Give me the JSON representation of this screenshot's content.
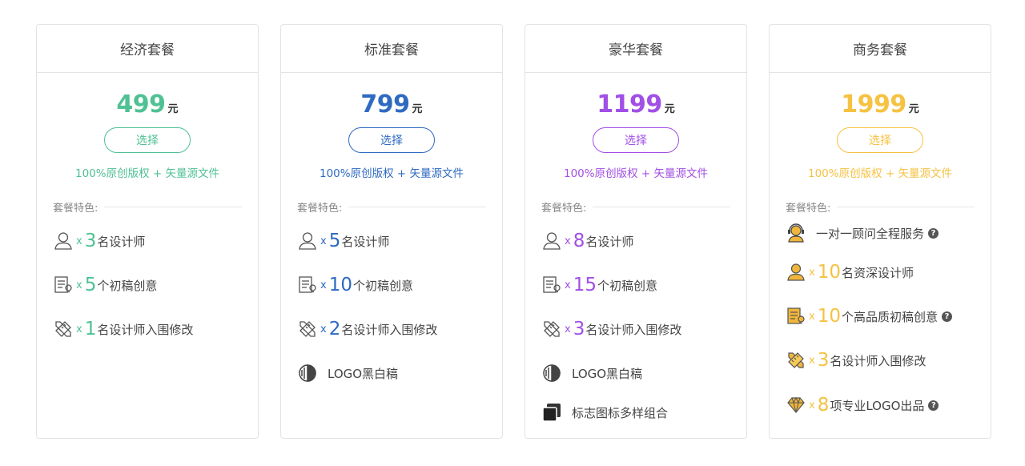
{
  "plans": [
    {
      "name": "经济套餐",
      "price": "499",
      "unit": "元",
      "select_label": "选择",
      "copyright": "100%原创版权 + 矢量源文件",
      "color": "#4fc194",
      "features_title": "套餐特色:",
      "features": [
        {
          "icon": "designer-icon",
          "x": "x",
          "num": "3",
          "text": "名设计师"
        },
        {
          "icon": "draft-idea-icon",
          "x": "x",
          "num": "5",
          "text": "个初稿创意"
        },
        {
          "icon": "pencil-ruler-icon",
          "x": "x",
          "num": "1",
          "text": "名设计师入围修改"
        }
      ]
    },
    {
      "name": "标准套餐",
      "price": "799",
      "unit": "元",
      "select_label": "选择",
      "copyright": "100%原创版权 + 矢量源文件",
      "color": "#2e6ac1",
      "features_title": "套餐特色:",
      "features": [
        {
          "icon": "designer-icon",
          "x": "x",
          "num": "5",
          "text": "名设计师"
        },
        {
          "icon": "draft-idea-icon",
          "x": "x",
          "num": "10",
          "text": "个初稿创意"
        },
        {
          "icon": "pencil-ruler-icon",
          "x": "x",
          "num": "2",
          "text": "名设计师入围修改"
        },
        {
          "icon": "contrast-icon",
          "text": "LOGO黑白稿"
        }
      ]
    },
    {
      "name": "豪华套餐",
      "price": "1199",
      "unit": "元",
      "select_label": "选择",
      "copyright": "100%原创版权 + 矢量源文件",
      "color": "#a14fe6",
      "features_title": "套餐特色:",
      "features": [
        {
          "icon": "designer-icon",
          "x": "x",
          "num": "8",
          "text": "名设计师"
        },
        {
          "icon": "draft-idea-icon",
          "x": "x",
          "num": "15",
          "text": "个初稿创意"
        },
        {
          "icon": "pencil-ruler-icon",
          "x": "x",
          "num": "3",
          "text": "名设计师入围修改"
        },
        {
          "icon": "contrast-icon",
          "text": "LOGO黑白稿"
        },
        {
          "icon": "stacked-squares-icon",
          "text": "标志图标多样组合"
        }
      ]
    },
    {
      "name": "商务套餐",
      "price": "1999",
      "unit": "元",
      "select_label": "选择",
      "copyright": "100%原创版权 + 矢量源文件",
      "color": "#f5c241",
      "features_title": "套餐特色:",
      "features": [
        {
          "icon": "consultant-icon",
          "text": "一对一顾问全程服务",
          "help": "?"
        },
        {
          "icon": "designer-gold-icon",
          "x": "x",
          "num": "10",
          "text": "名资深设计师"
        },
        {
          "icon": "draft-idea-gold-icon",
          "x": "x",
          "num": "10",
          "text": "个高品质初稿创意",
          "help": "?"
        },
        {
          "icon": "pencil-ruler-gold-icon",
          "x": "x",
          "num": "3",
          "text": "名设计师入围修改"
        },
        {
          "icon": "diamond-icon",
          "x": "x",
          "num": "8",
          "text": "项专业LOGO出品",
          "help": "?"
        }
      ]
    }
  ]
}
